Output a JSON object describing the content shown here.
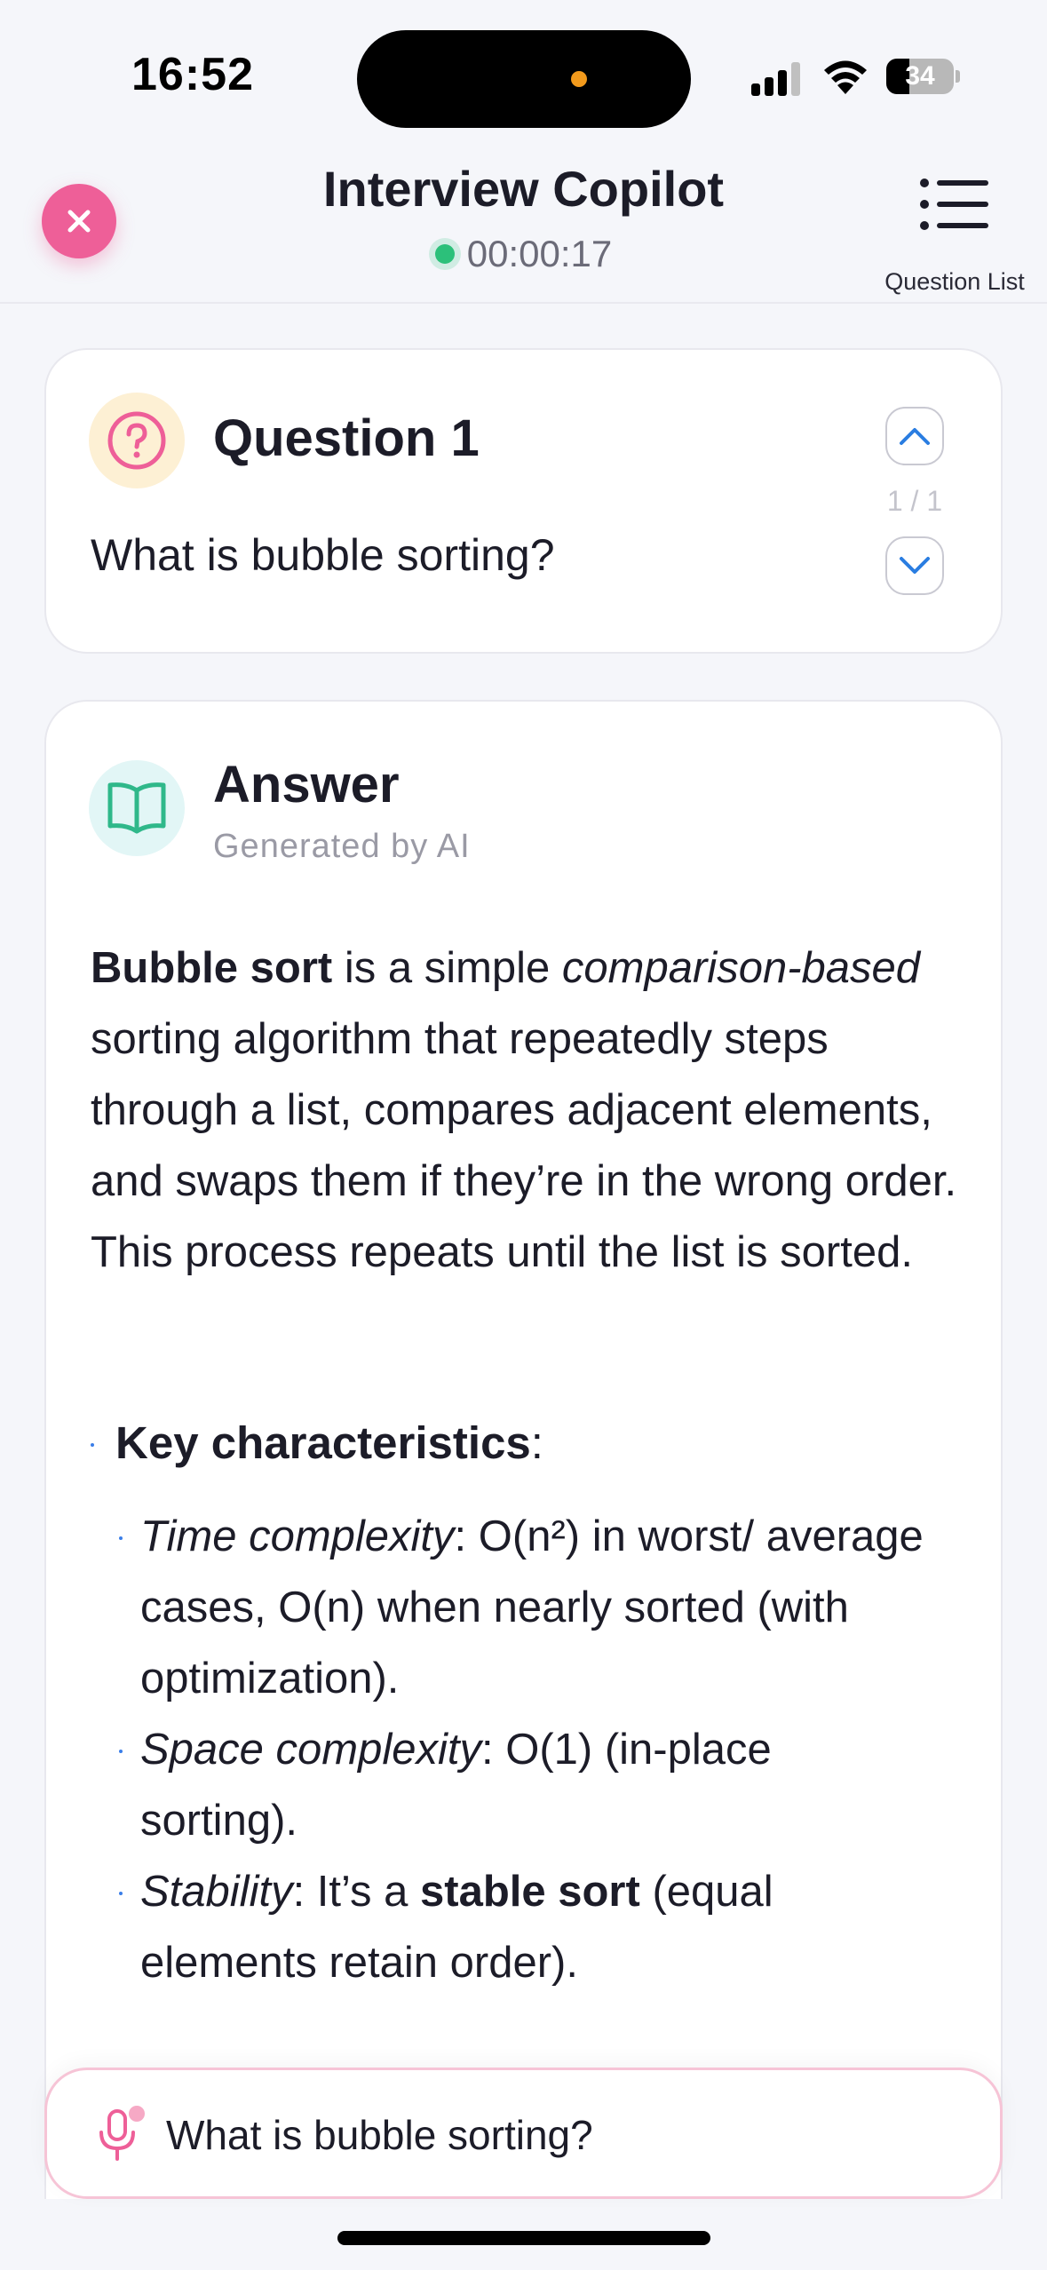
{
  "status_bar": {
    "time": "16:52",
    "battery_percent": 34,
    "battery_label": "34"
  },
  "header": {
    "title": "Interview Copilot",
    "timer": "00:00:17",
    "question_list_label": "Question List"
  },
  "question": {
    "title": "Question 1",
    "text": "What is bubble sorting?",
    "counter": "1 / 1"
  },
  "answer": {
    "title": "Answer",
    "subtitle": "Generated by AI",
    "intro": {
      "bold_term": "Bubble sort",
      "part1": " is a simple ",
      "italic_term": "comparison-based",
      "part2": " sorting algorithm that repeatedly steps through a list, compares adjacent elements, and swaps them if they’re in the wrong order. This process repeats until the list is sorted."
    },
    "key_heading": "Key characteristics",
    "key_colon": ":",
    "characteristics": [
      {
        "label": "Time complexity",
        "text": ": O(n²) in worst/ average cases, O(n) when nearly sorted (with optimization)."
      },
      {
        "label": "Space complexity",
        "text": ": O(1) (in-place sorting)."
      },
      {
        "label": "Stability",
        "text_before": ": It’s a ",
        "bold": "stable sort",
        "text_after": " (equal elements retain order)."
      }
    ]
  },
  "input": {
    "text": "What is bubble sorting?"
  },
  "colors": {
    "accent_pink": "#ee5f98",
    "accent_blue": "#2a7de1",
    "timer_green": "#2cc07a",
    "book_teal": "#2fb88a"
  }
}
